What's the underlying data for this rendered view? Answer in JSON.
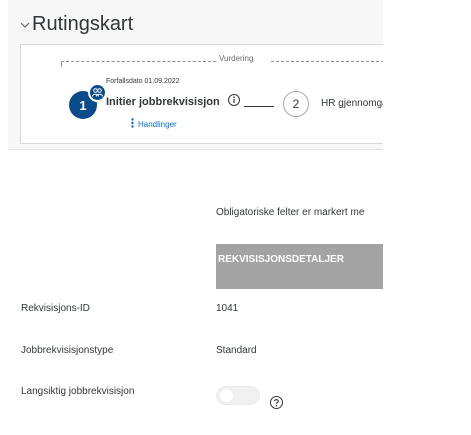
{
  "section": {
    "title": "Rutingskart",
    "expanded": true,
    "icon": "chevron-down-icon"
  },
  "route_map": {
    "phase_label": "Vurdering",
    "steps": [
      {
        "number": "1",
        "due_date": "Forfallsdato 01.09.2022",
        "title": "Initier jobbrekvisisjon",
        "actions_label": "Handlinger",
        "badge_icon": "people-icon"
      },
      {
        "number": "2",
        "title": "HR gjennomgar"
      }
    ]
  },
  "form": {
    "required_note": "Obligatoriske felter er markert me",
    "group_header": "REKVISISJONSDETALJER",
    "fields": [
      {
        "label": "Rekvisisjons-ID",
        "value": "1041"
      },
      {
        "label": "Jobbrekvisisjonstype",
        "value": "Standard"
      },
      {
        "label": "Langsiktig jobbrekvisisjon",
        "toggle_on": false
      }
    ]
  },
  "colors": {
    "accent": "#0a4b8c",
    "link": "#0a6ed1",
    "group_header_bg": "#a3a3a3"
  }
}
